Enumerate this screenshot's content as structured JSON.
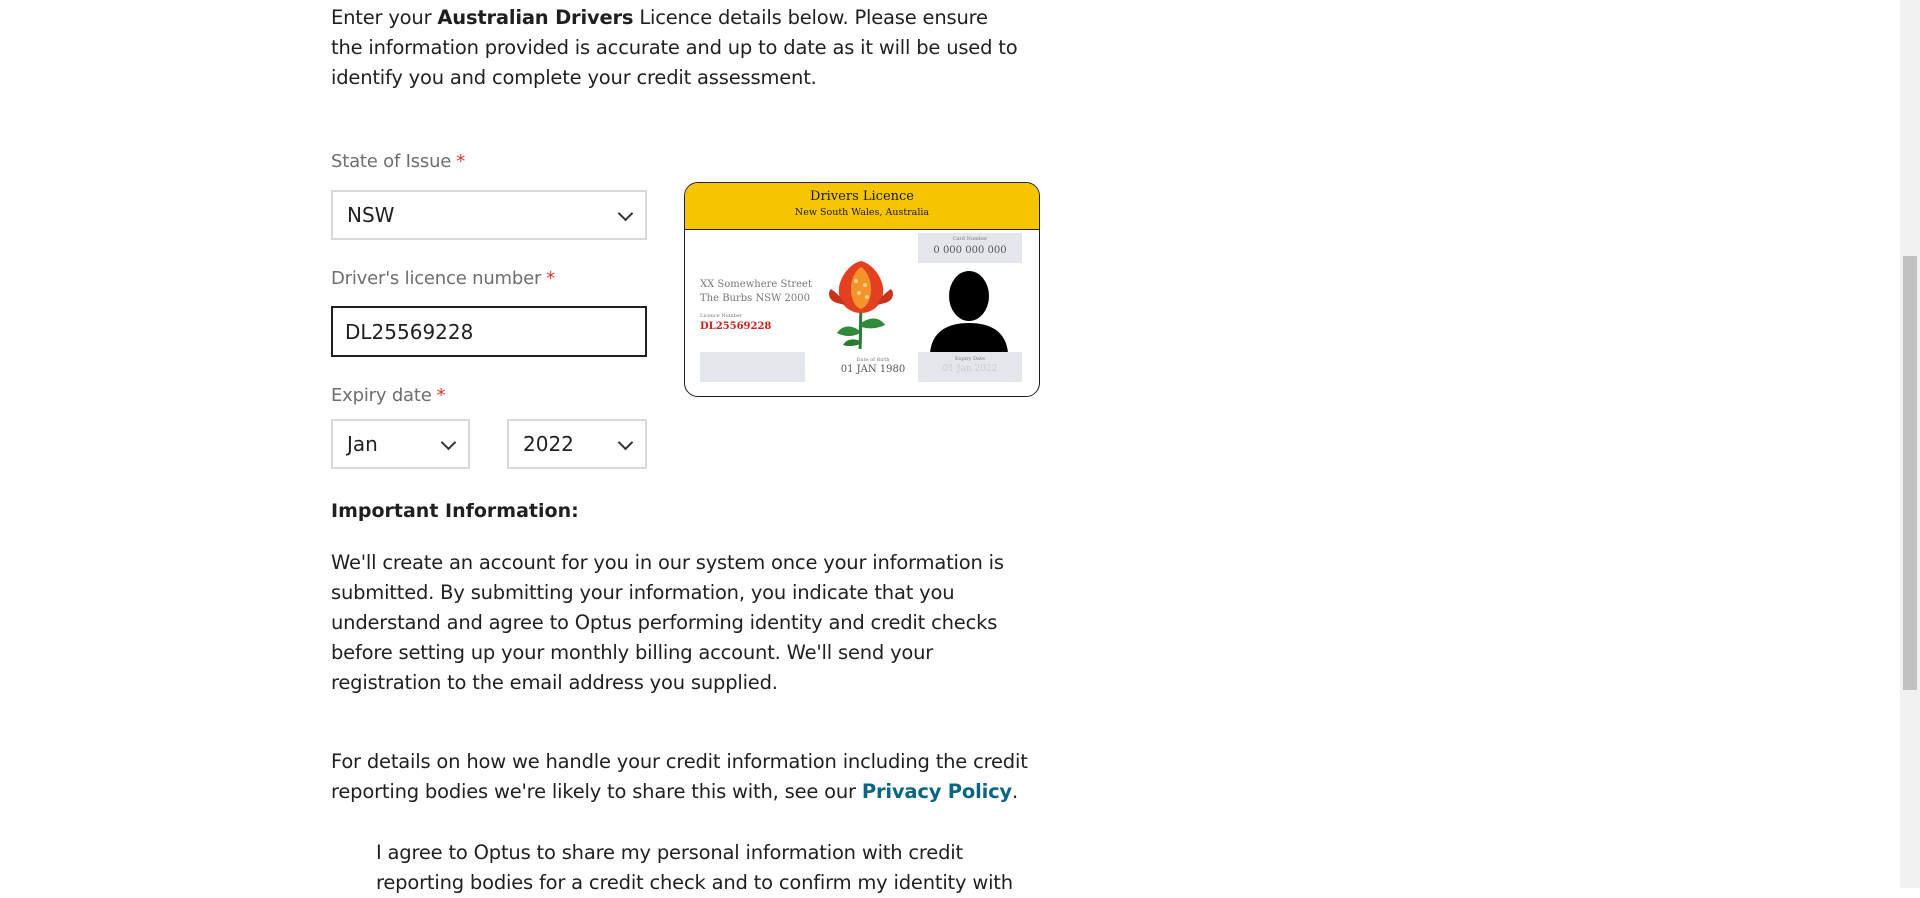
{
  "intro": {
    "prefix": "Enter your ",
    "bold": "Australian Drivers",
    "suffix": " Licence details below. Please ensure the information provided is accurate and up to date as it will be used to identify you and complete your credit assessment."
  },
  "form": {
    "state": {
      "label": "State of Issue",
      "required": "*",
      "value": "NSW"
    },
    "licence": {
      "label": "Driver's licence number",
      "required": "*",
      "value": "DL25569228"
    },
    "expiry": {
      "label": "Expiry date",
      "required": "*",
      "month": "Jan",
      "year": "2022"
    }
  },
  "card": {
    "title": "Drivers Licence",
    "subtitle": "New South Wales, Australia",
    "card_number_label": "Card Number",
    "card_number": "0 000 000 000",
    "address_line1": "XX Somewhere Street",
    "address_line2": "The Burbs NSW 2000",
    "licence_number_label": "Licence Number",
    "licence_number": "DL25569228",
    "dob_label": "Date of Birth",
    "dob": "01 JAN 1980",
    "expiry_label": "Expiry Date",
    "expiry": "01 Jan 2022"
  },
  "info": {
    "heading": "Important Information:",
    "paragraph1": "We'll create an account for you in our system once your information is submitted. By submitting your information, you indicate that you understand and agree to Optus performing identity and credit checks before setting up your monthly billing account. We'll send your registration to the email address you supplied.",
    "paragraph2_text": "For details on how we handle your credit information including the credit reporting bodies we're likely to share this with, see our ",
    "privacy_link": "Privacy Policy",
    "paragraph2_end": ".",
    "consent": "I agree to Optus to share my personal information with credit reporting bodies for a credit check and to confirm my identity with"
  },
  "colors": {
    "accent_yellow": "#f6c400",
    "link": "#0a6584",
    "required": "#d6372b",
    "licence_red": "#d0201b"
  }
}
